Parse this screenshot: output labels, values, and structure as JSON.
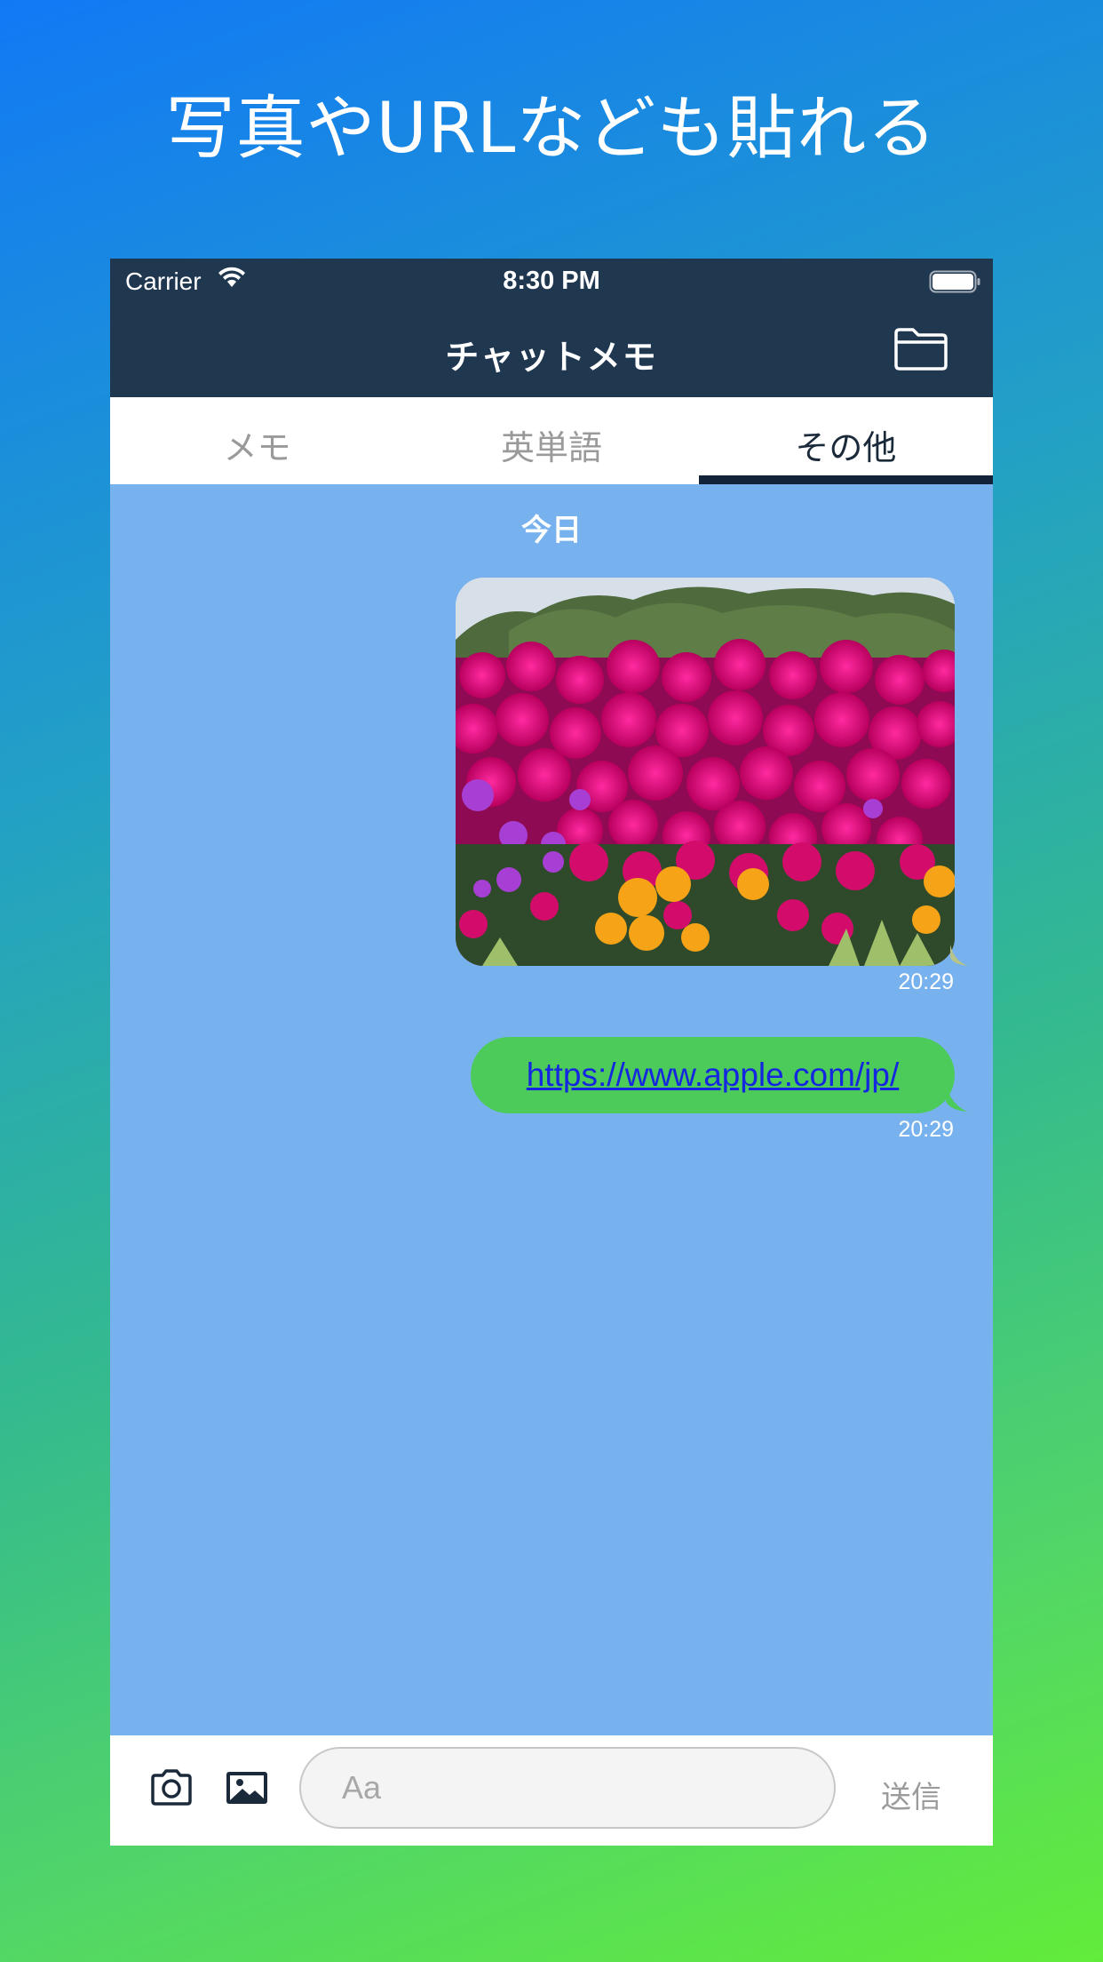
{
  "headline": "写真やURLなども貼れる",
  "status_bar": {
    "carrier": "Carrier",
    "time": "8:30 PM"
  },
  "nav": {
    "title": "チャットメモ",
    "folder_icon": "folder-icon"
  },
  "tabs": [
    {
      "label": "メモ",
      "active": false
    },
    {
      "label": "英単語",
      "active": false
    },
    {
      "label": "その他",
      "active": true
    }
  ],
  "chat": {
    "date_separator": "今日",
    "messages": [
      {
        "type": "image",
        "content": "flower-field-photo",
        "time": "20:29"
      },
      {
        "type": "link",
        "text": "https://www.apple.com/jp/",
        "time": "20:29"
      }
    ]
  },
  "input_bar": {
    "camera_icon": "camera-icon",
    "photo_icon": "photo-library-icon",
    "placeholder": "Aa",
    "send_label": "送信"
  },
  "colors": {
    "nav_background": "#203750",
    "chat_background": "#77b1ee",
    "bubble_green": "#4dcb5a",
    "link_blue": "#1526e0",
    "tab_indicator": "#122238"
  }
}
